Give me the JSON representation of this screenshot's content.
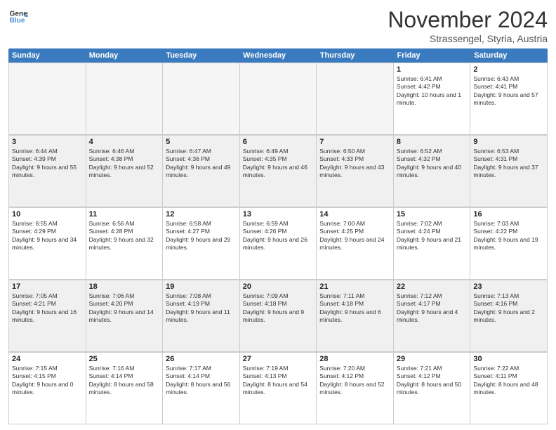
{
  "header": {
    "logo_line1": "General",
    "logo_line2": "Blue",
    "month": "November 2024",
    "location": "Strassengel, Styria, Austria"
  },
  "weekdays": [
    "Sunday",
    "Monday",
    "Tuesday",
    "Wednesday",
    "Thursday",
    "Friday",
    "Saturday"
  ],
  "weeks": [
    [
      {
        "day": "",
        "empty": true
      },
      {
        "day": "",
        "empty": true
      },
      {
        "day": "",
        "empty": true
      },
      {
        "day": "",
        "empty": true
      },
      {
        "day": "",
        "empty": true
      },
      {
        "day": "1",
        "sunrise": "6:41 AM",
        "sunset": "4:42 PM",
        "daylight": "10 hours and 1 minute."
      },
      {
        "day": "2",
        "sunrise": "6:43 AM",
        "sunset": "4:41 PM",
        "daylight": "9 hours and 57 minutes."
      }
    ],
    [
      {
        "day": "3",
        "sunrise": "6:44 AM",
        "sunset": "4:39 PM",
        "daylight": "9 hours and 55 minutes."
      },
      {
        "day": "4",
        "sunrise": "6:46 AM",
        "sunset": "4:38 PM",
        "daylight": "9 hours and 52 minutes."
      },
      {
        "day": "5",
        "sunrise": "6:47 AM",
        "sunset": "4:36 PM",
        "daylight": "9 hours and 49 minutes."
      },
      {
        "day": "6",
        "sunrise": "6:49 AM",
        "sunset": "4:35 PM",
        "daylight": "9 hours and 46 minutes."
      },
      {
        "day": "7",
        "sunrise": "6:50 AM",
        "sunset": "4:33 PM",
        "daylight": "9 hours and 43 minutes."
      },
      {
        "day": "8",
        "sunrise": "6:52 AM",
        "sunset": "4:32 PM",
        "daylight": "9 hours and 40 minutes."
      },
      {
        "day": "9",
        "sunrise": "6:53 AM",
        "sunset": "4:31 PM",
        "daylight": "9 hours and 37 minutes."
      }
    ],
    [
      {
        "day": "10",
        "sunrise": "6:55 AM",
        "sunset": "4:29 PM",
        "daylight": "9 hours and 34 minutes."
      },
      {
        "day": "11",
        "sunrise": "6:56 AM",
        "sunset": "4:28 PM",
        "daylight": "9 hours and 32 minutes."
      },
      {
        "day": "12",
        "sunrise": "6:58 AM",
        "sunset": "4:27 PM",
        "daylight": "9 hours and 29 minutes."
      },
      {
        "day": "13",
        "sunrise": "6:59 AM",
        "sunset": "4:26 PM",
        "daylight": "9 hours and 26 minutes."
      },
      {
        "day": "14",
        "sunrise": "7:00 AM",
        "sunset": "4:25 PM",
        "daylight": "9 hours and 24 minutes."
      },
      {
        "day": "15",
        "sunrise": "7:02 AM",
        "sunset": "4:24 PM",
        "daylight": "9 hours and 21 minutes."
      },
      {
        "day": "16",
        "sunrise": "7:03 AM",
        "sunset": "4:22 PM",
        "daylight": "9 hours and 19 minutes."
      }
    ],
    [
      {
        "day": "17",
        "sunrise": "7:05 AM",
        "sunset": "4:21 PM",
        "daylight": "9 hours and 16 minutes."
      },
      {
        "day": "18",
        "sunrise": "7:06 AM",
        "sunset": "4:20 PM",
        "daylight": "9 hours and 14 minutes."
      },
      {
        "day": "19",
        "sunrise": "7:08 AM",
        "sunset": "4:19 PM",
        "daylight": "9 hours and 11 minutes."
      },
      {
        "day": "20",
        "sunrise": "7:09 AM",
        "sunset": "4:18 PM",
        "daylight": "9 hours and 9 minutes."
      },
      {
        "day": "21",
        "sunrise": "7:11 AM",
        "sunset": "4:18 PM",
        "daylight": "9 hours and 6 minutes."
      },
      {
        "day": "22",
        "sunrise": "7:12 AM",
        "sunset": "4:17 PM",
        "daylight": "9 hours and 4 minutes."
      },
      {
        "day": "23",
        "sunrise": "7:13 AM",
        "sunset": "4:16 PM",
        "daylight": "9 hours and 2 minutes."
      }
    ],
    [
      {
        "day": "24",
        "sunrise": "7:15 AM",
        "sunset": "4:15 PM",
        "daylight": "9 hours and 0 minutes."
      },
      {
        "day": "25",
        "sunrise": "7:16 AM",
        "sunset": "4:14 PM",
        "daylight": "8 hours and 58 minutes."
      },
      {
        "day": "26",
        "sunrise": "7:17 AM",
        "sunset": "4:14 PM",
        "daylight": "8 hours and 56 minutes."
      },
      {
        "day": "27",
        "sunrise": "7:19 AM",
        "sunset": "4:13 PM",
        "daylight": "8 hours and 54 minutes."
      },
      {
        "day": "28",
        "sunrise": "7:20 AM",
        "sunset": "4:12 PM",
        "daylight": "8 hours and 52 minutes."
      },
      {
        "day": "29",
        "sunrise": "7:21 AM",
        "sunset": "4:12 PM",
        "daylight": "8 hours and 50 minutes."
      },
      {
        "day": "30",
        "sunrise": "7:22 AM",
        "sunset": "4:11 PM",
        "daylight": "8 hours and 48 minutes."
      }
    ]
  ]
}
